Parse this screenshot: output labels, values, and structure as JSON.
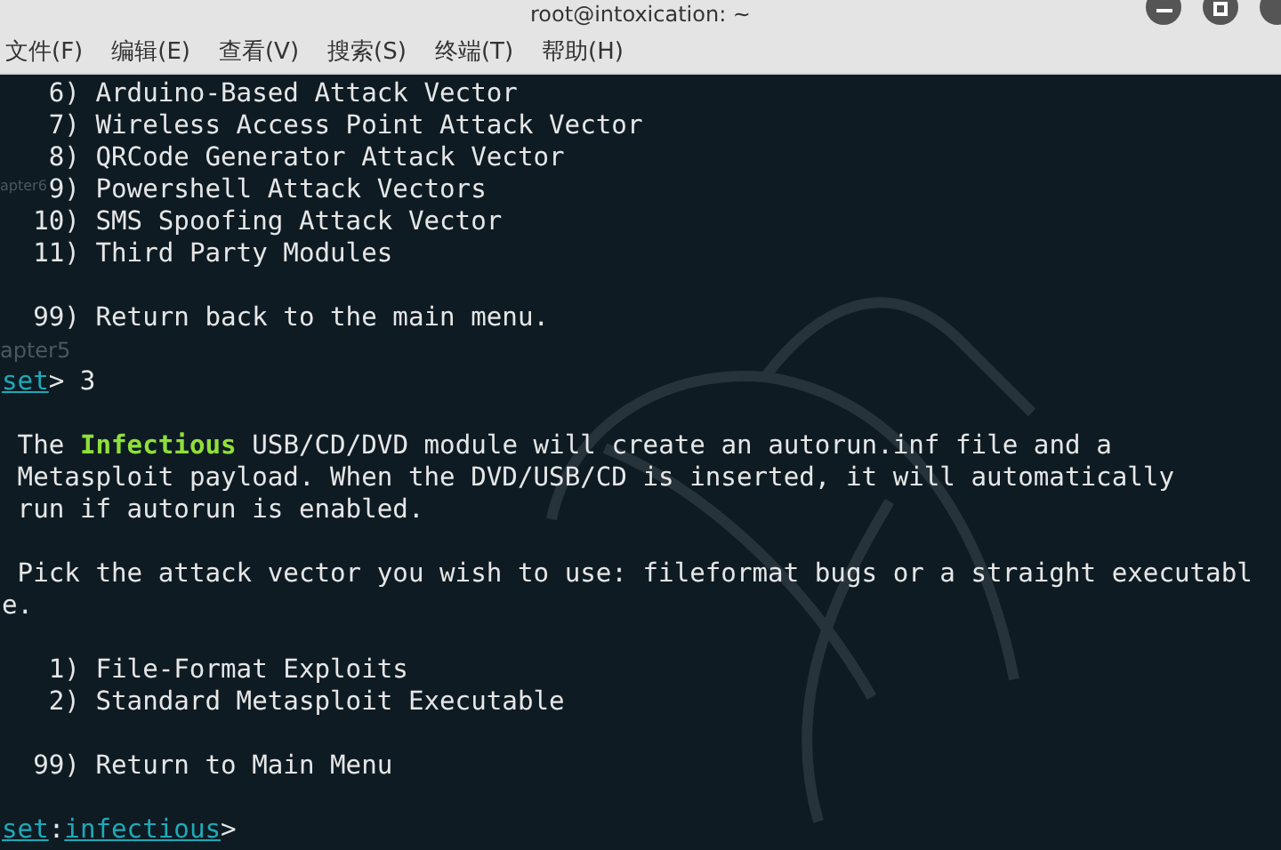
{
  "window": {
    "title": "root@intoxication: ~"
  },
  "menu": [
    "文件(F)",
    "编辑(E)",
    "查看(V)",
    "搜索(S)",
    "终端(T)",
    "帮助(H)"
  ],
  "desktop_labels": [
    {
      "text": "apter6"
    },
    {
      "text": "apter5"
    }
  ],
  "terminal_lines": [
    {
      "blank_before": false,
      "segments": [
        {
          "kind": "text",
          "text": "   6) Arduino-Based Attack Vector"
        }
      ]
    },
    {
      "blank_before": false,
      "segments": [
        {
          "kind": "text",
          "text": "   7) Wireless Access Point Attack Vector"
        }
      ]
    },
    {
      "blank_before": false,
      "segments": [
        {
          "kind": "text",
          "text": "   8) QRCode Generator Attack Vector"
        }
      ]
    },
    {
      "blank_before": false,
      "segments": [
        {
          "kind": "text",
          "text": "   9) Powershell Attack Vectors"
        }
      ]
    },
    {
      "blank_before": false,
      "segments": [
        {
          "kind": "text",
          "text": "  10) SMS Spoofing Attack Vector"
        }
      ]
    },
    {
      "blank_before": false,
      "segments": [
        {
          "kind": "text",
          "text": "  11) Third Party Modules"
        }
      ]
    },
    {
      "blank_before": true,
      "segments": [
        {
          "kind": "text",
          "text": "  99) Return back to the main menu."
        }
      ]
    },
    {
      "blank_before": true,
      "segments": [
        {
          "kind": "prompt",
          "text": "set"
        },
        {
          "kind": "text",
          "text": "> 3"
        }
      ]
    },
    {
      "blank_before": true,
      "segments": [
        {
          "kind": "text",
          "text": " The "
        },
        {
          "kind": "highlight",
          "text": "Infectious"
        },
        {
          "kind": "text",
          "text": " USB/CD/DVD module will create an autorun.inf file and a"
        }
      ]
    },
    {
      "blank_before": false,
      "segments": [
        {
          "kind": "text",
          "text": " Metasploit payload. When the DVD/USB/CD is inserted, it will automatically"
        }
      ]
    },
    {
      "blank_before": false,
      "segments": [
        {
          "kind": "text",
          "text": " run if autorun is enabled."
        }
      ]
    },
    {
      "blank_before": true,
      "segments": [
        {
          "kind": "text",
          "text": " Pick the attack vector you wish to use: fileformat bugs or a straight executabl"
        }
      ]
    },
    {
      "blank_before": false,
      "segments": [
        {
          "kind": "text",
          "text": "e."
        }
      ]
    },
    {
      "blank_before": true,
      "segments": [
        {
          "kind": "text",
          "text": "   1) File-Format Exploits"
        }
      ]
    },
    {
      "blank_before": false,
      "segments": [
        {
          "kind": "text",
          "text": "   2) Standard Metasploit Executable"
        }
      ]
    },
    {
      "blank_before": true,
      "segments": [
        {
          "kind": "text",
          "text": "  99) Return to Main Menu"
        }
      ]
    },
    {
      "blank_before": true,
      "segments": [
        {
          "kind": "prompt",
          "text": "set"
        },
        {
          "kind": "text",
          "text": ":"
        },
        {
          "kind": "prompt",
          "text": "infectious"
        },
        {
          "kind": "text",
          "text": ">"
        }
      ]
    }
  ]
}
